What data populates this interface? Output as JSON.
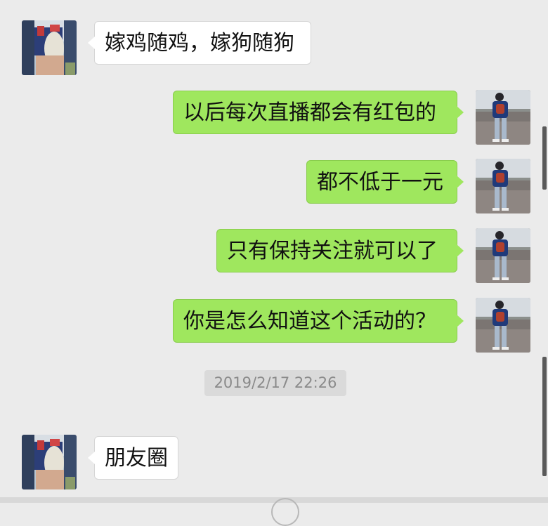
{
  "colors": {
    "background": "#ebebeb",
    "left_bubble": "#ffffff",
    "right_bubble": "#9fe75e",
    "timestamp_bg": "#dadada"
  },
  "messages": [
    {
      "side": "left",
      "text": "嫁鸡随鸡，嫁狗随狗",
      "avatar": "girl-avatar"
    },
    {
      "side": "right",
      "text": "以后每次直播都会有红包的",
      "avatar": "walker-avatar"
    },
    {
      "side": "right",
      "text": "都不低于一元",
      "avatar": "walker-avatar"
    },
    {
      "side": "right",
      "text": "只有保持关注就可以了",
      "avatar": "walker-avatar"
    },
    {
      "side": "right",
      "text": "你是怎么知道这个活动的？",
      "avatar": "walker-avatar"
    },
    {
      "side": "left",
      "text": "朋友圈",
      "avatar": "girl-avatar"
    }
  ],
  "timestamp": "2019/2/17 22:26"
}
